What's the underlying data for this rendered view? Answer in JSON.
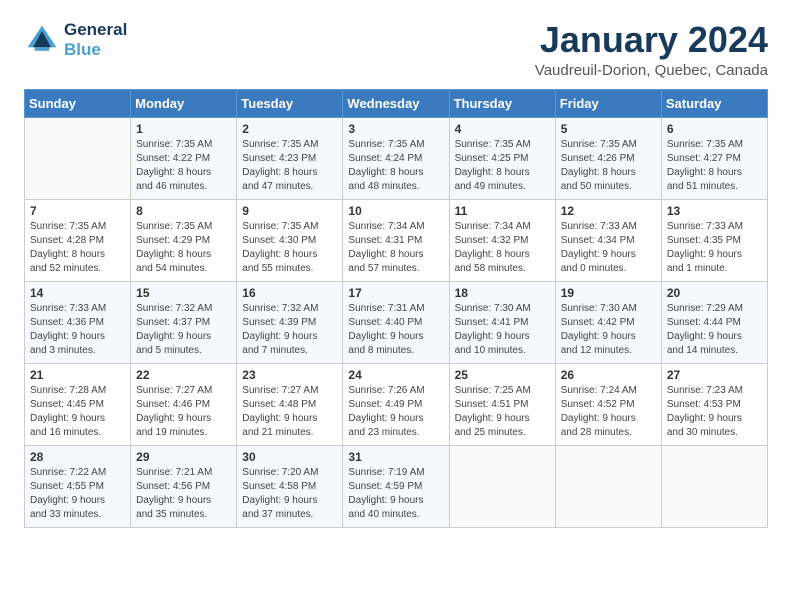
{
  "header": {
    "logo_line1": "General",
    "logo_line2": "Blue",
    "main_title": "January 2024",
    "subtitle": "Vaudreuil-Dorion, Quebec, Canada"
  },
  "days_of_week": [
    "Sunday",
    "Monday",
    "Tuesday",
    "Wednesday",
    "Thursday",
    "Friday",
    "Saturday"
  ],
  "weeks": [
    [
      {
        "day": "",
        "info": ""
      },
      {
        "day": "1",
        "info": "Sunrise: 7:35 AM\nSunset: 4:22 PM\nDaylight: 8 hours\nand 46 minutes."
      },
      {
        "day": "2",
        "info": "Sunrise: 7:35 AM\nSunset: 4:23 PM\nDaylight: 8 hours\nand 47 minutes."
      },
      {
        "day": "3",
        "info": "Sunrise: 7:35 AM\nSunset: 4:24 PM\nDaylight: 8 hours\nand 48 minutes."
      },
      {
        "day": "4",
        "info": "Sunrise: 7:35 AM\nSunset: 4:25 PM\nDaylight: 8 hours\nand 49 minutes."
      },
      {
        "day": "5",
        "info": "Sunrise: 7:35 AM\nSunset: 4:26 PM\nDaylight: 8 hours\nand 50 minutes."
      },
      {
        "day": "6",
        "info": "Sunrise: 7:35 AM\nSunset: 4:27 PM\nDaylight: 8 hours\nand 51 minutes."
      }
    ],
    [
      {
        "day": "7",
        "info": "Sunrise: 7:35 AM\nSunset: 4:28 PM\nDaylight: 8 hours\nand 52 minutes."
      },
      {
        "day": "8",
        "info": "Sunrise: 7:35 AM\nSunset: 4:29 PM\nDaylight: 8 hours\nand 54 minutes."
      },
      {
        "day": "9",
        "info": "Sunrise: 7:35 AM\nSunset: 4:30 PM\nDaylight: 8 hours\nand 55 minutes."
      },
      {
        "day": "10",
        "info": "Sunrise: 7:34 AM\nSunset: 4:31 PM\nDaylight: 8 hours\nand 57 minutes."
      },
      {
        "day": "11",
        "info": "Sunrise: 7:34 AM\nSunset: 4:32 PM\nDaylight: 8 hours\nand 58 minutes."
      },
      {
        "day": "12",
        "info": "Sunrise: 7:33 AM\nSunset: 4:34 PM\nDaylight: 9 hours\nand 0 minutes."
      },
      {
        "day": "13",
        "info": "Sunrise: 7:33 AM\nSunset: 4:35 PM\nDaylight: 9 hours\nand 1 minute."
      }
    ],
    [
      {
        "day": "14",
        "info": "Sunrise: 7:33 AM\nSunset: 4:36 PM\nDaylight: 9 hours\nand 3 minutes."
      },
      {
        "day": "15",
        "info": "Sunrise: 7:32 AM\nSunset: 4:37 PM\nDaylight: 9 hours\nand 5 minutes."
      },
      {
        "day": "16",
        "info": "Sunrise: 7:32 AM\nSunset: 4:39 PM\nDaylight: 9 hours\nand 7 minutes."
      },
      {
        "day": "17",
        "info": "Sunrise: 7:31 AM\nSunset: 4:40 PM\nDaylight: 9 hours\nand 8 minutes."
      },
      {
        "day": "18",
        "info": "Sunrise: 7:30 AM\nSunset: 4:41 PM\nDaylight: 9 hours\nand 10 minutes."
      },
      {
        "day": "19",
        "info": "Sunrise: 7:30 AM\nSunset: 4:42 PM\nDaylight: 9 hours\nand 12 minutes."
      },
      {
        "day": "20",
        "info": "Sunrise: 7:29 AM\nSunset: 4:44 PM\nDaylight: 9 hours\nand 14 minutes."
      }
    ],
    [
      {
        "day": "21",
        "info": "Sunrise: 7:28 AM\nSunset: 4:45 PM\nDaylight: 9 hours\nand 16 minutes."
      },
      {
        "day": "22",
        "info": "Sunrise: 7:27 AM\nSunset: 4:46 PM\nDaylight: 9 hours\nand 19 minutes."
      },
      {
        "day": "23",
        "info": "Sunrise: 7:27 AM\nSunset: 4:48 PM\nDaylight: 9 hours\nand 21 minutes."
      },
      {
        "day": "24",
        "info": "Sunrise: 7:26 AM\nSunset: 4:49 PM\nDaylight: 9 hours\nand 23 minutes."
      },
      {
        "day": "25",
        "info": "Sunrise: 7:25 AM\nSunset: 4:51 PM\nDaylight: 9 hours\nand 25 minutes."
      },
      {
        "day": "26",
        "info": "Sunrise: 7:24 AM\nSunset: 4:52 PM\nDaylight: 9 hours\nand 28 minutes."
      },
      {
        "day": "27",
        "info": "Sunrise: 7:23 AM\nSunset: 4:53 PM\nDaylight: 9 hours\nand 30 minutes."
      }
    ],
    [
      {
        "day": "28",
        "info": "Sunrise: 7:22 AM\nSunset: 4:55 PM\nDaylight: 9 hours\nand 33 minutes."
      },
      {
        "day": "29",
        "info": "Sunrise: 7:21 AM\nSunset: 4:56 PM\nDaylight: 9 hours\nand 35 minutes."
      },
      {
        "day": "30",
        "info": "Sunrise: 7:20 AM\nSunset: 4:58 PM\nDaylight: 9 hours\nand 37 minutes."
      },
      {
        "day": "31",
        "info": "Sunrise: 7:19 AM\nSunset: 4:59 PM\nDaylight: 9 hours\nand 40 minutes."
      },
      {
        "day": "",
        "info": ""
      },
      {
        "day": "",
        "info": ""
      },
      {
        "day": "",
        "info": ""
      }
    ]
  ]
}
